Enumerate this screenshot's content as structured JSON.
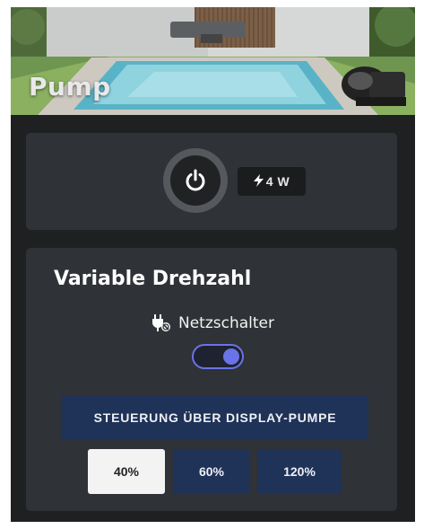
{
  "header": {
    "title": "Pump"
  },
  "power": {
    "button_icon": "power-icon",
    "state": "on",
    "watt_icon": "bolt-icon",
    "watt_value": "4 W"
  },
  "speed": {
    "title": "Variable Drehzahl",
    "switch_icon": "plug-icon",
    "switch_label": "Netzschalter",
    "switch_on": true,
    "mode_label": "STEUERUNG ÜBER DISPLAY-PUMPE",
    "options": [
      "40%",
      "60%",
      "120%"
    ],
    "selected": "40%"
  },
  "colors": {
    "accent": "#6a73e8",
    "button_dark_blue": "#1f3257",
    "card_bg": "#2f3236",
    "panel_bg": "#1e2022"
  }
}
